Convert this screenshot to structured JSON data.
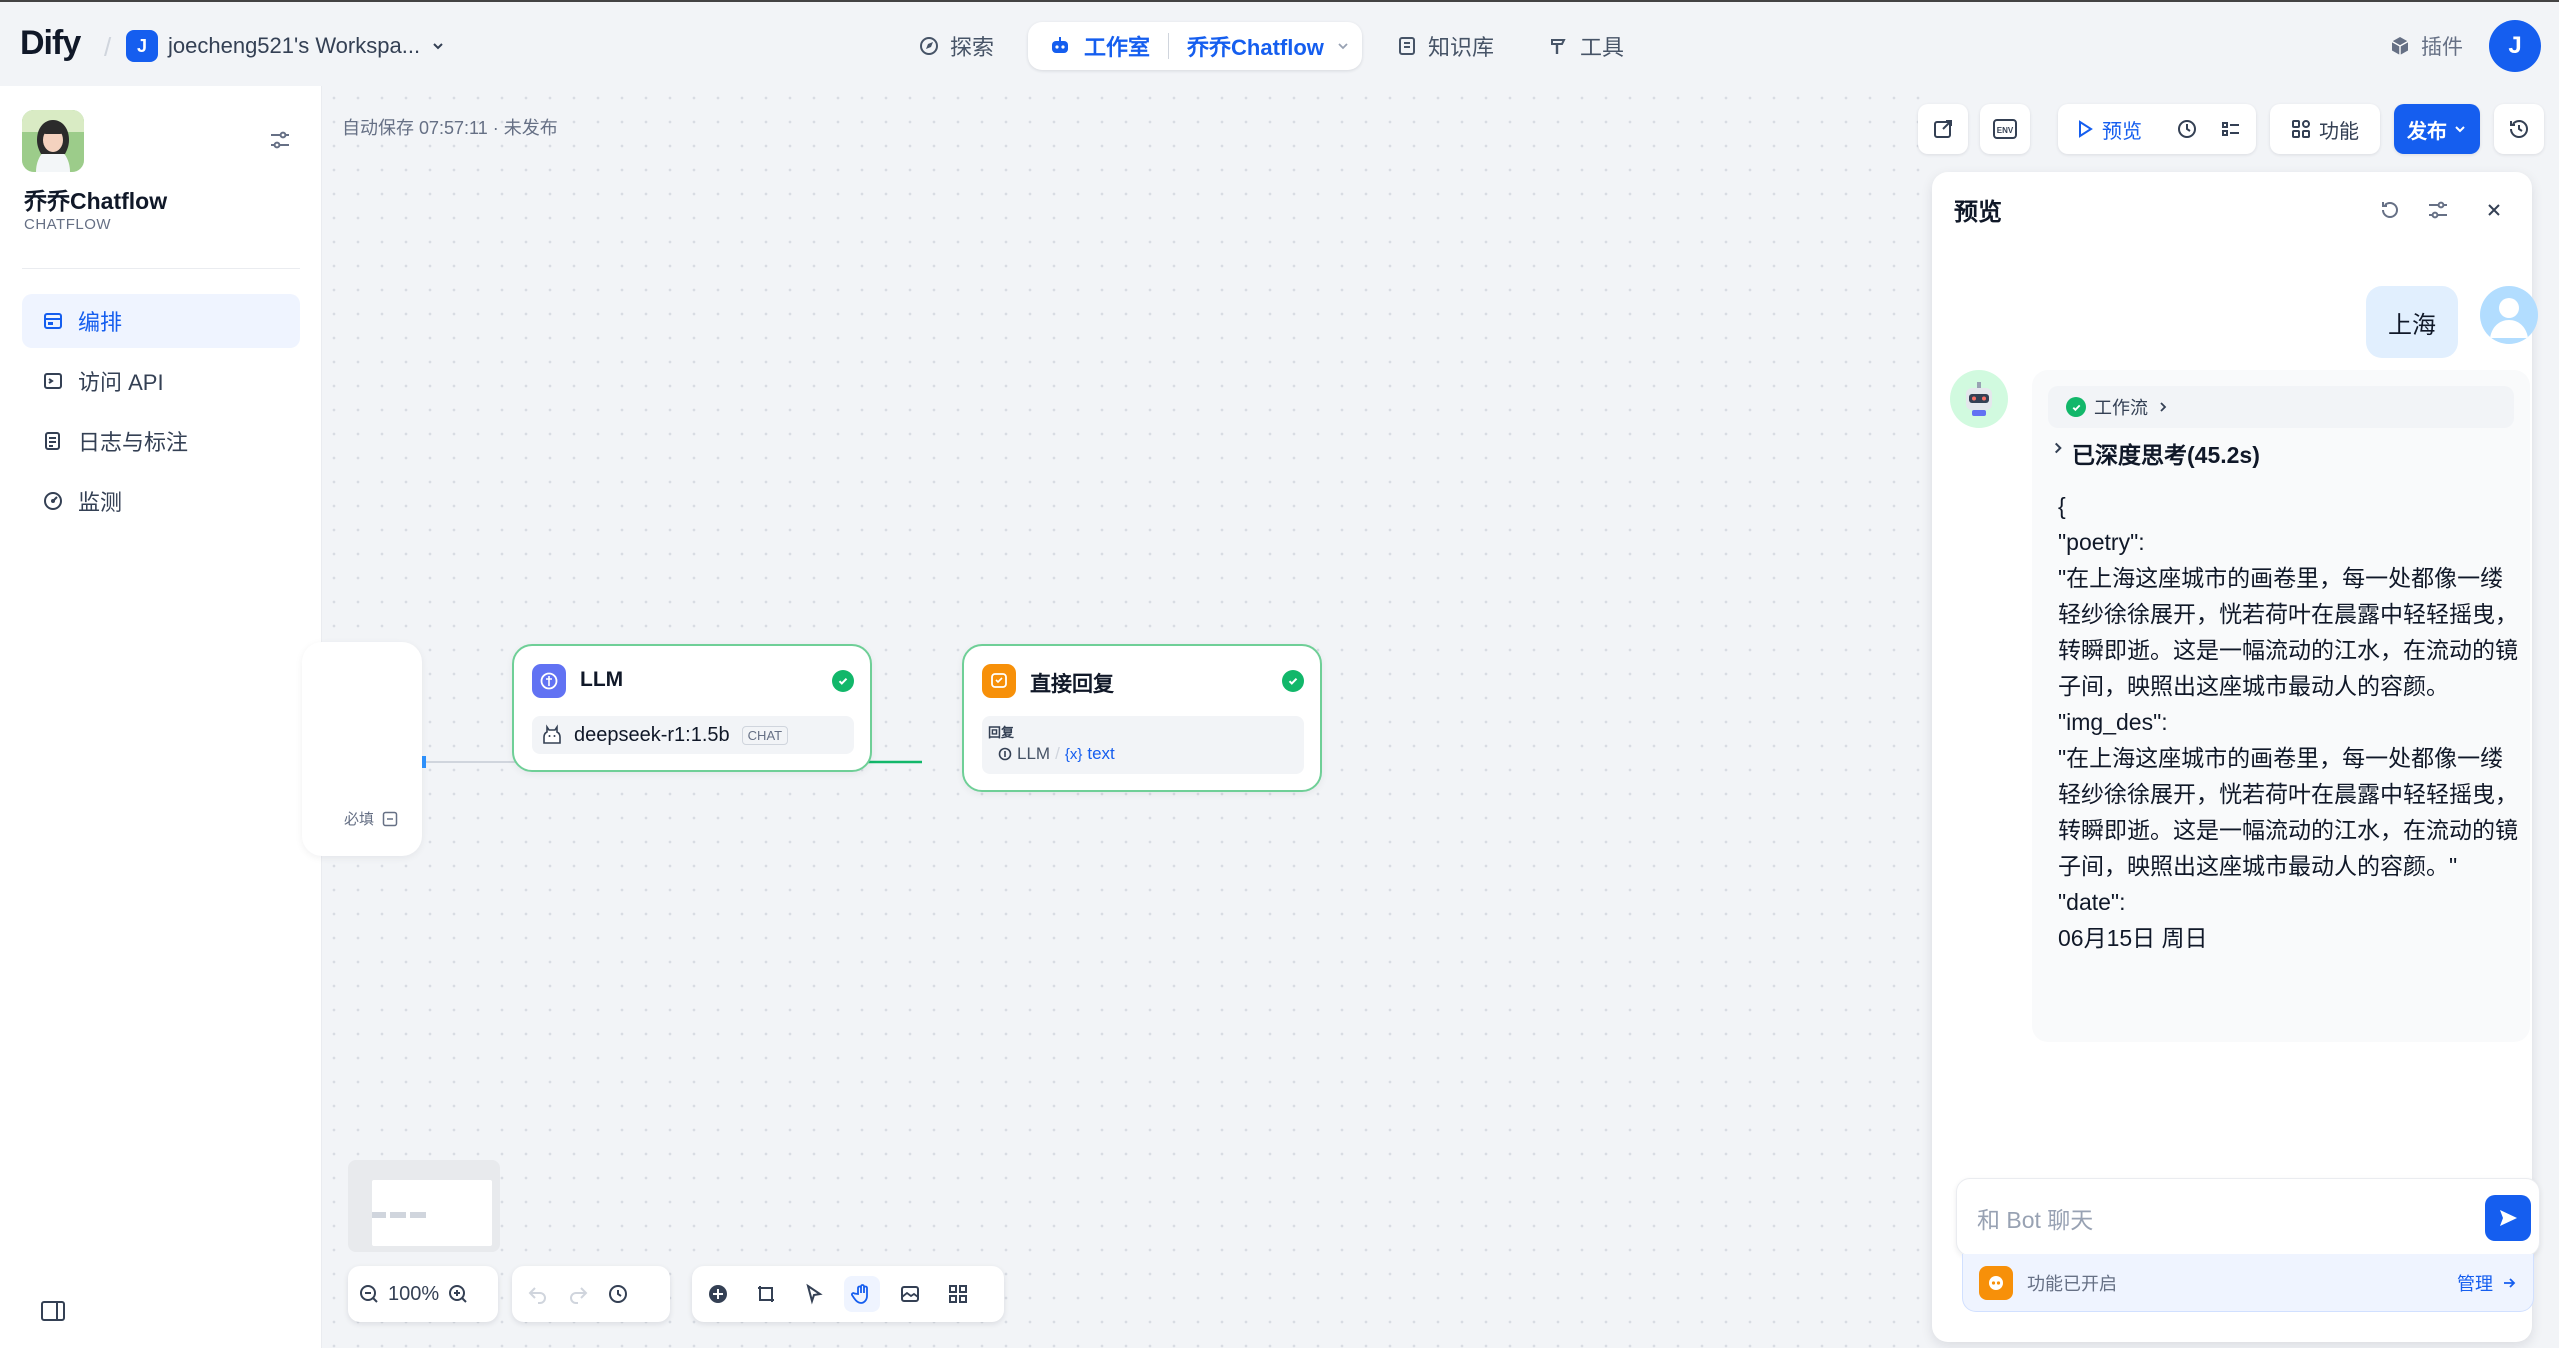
{
  "header": {
    "logo": "Dify",
    "workspace_initial": "J",
    "workspace_name": "joecheng521's Workspa...",
    "nav": {
      "explore": "探索",
      "studio": "工作室",
      "app": "乔乔Chatflow",
      "knowledge": "知识库",
      "tools": "工具"
    },
    "plugins": "插件",
    "user_initial": "J"
  },
  "sidebar": {
    "app_name": "乔乔Chatflow",
    "app_type": "CHATFLOW",
    "items": [
      {
        "label": "编排",
        "icon": "orchestrate-icon",
        "active": true
      },
      {
        "label": "访问 API",
        "icon": "terminal-icon",
        "active": false
      },
      {
        "label": "日志与标注",
        "icon": "logs-icon",
        "active": false
      },
      {
        "label": "监测",
        "icon": "monitor-icon",
        "active": false
      }
    ]
  },
  "canvas": {
    "autosave": "自动保存 07:57:11 · 未发布",
    "start_node": {
      "required": "必填"
    },
    "llm_node": {
      "title": "LLM",
      "model": "deepseek-r1:1.5b",
      "model_tag": "CHAT"
    },
    "answer_node": {
      "title": "直接回复",
      "label": "回复",
      "var_source": "LLM",
      "var_sep": "/",
      "var_name": "text"
    },
    "zoom": "100%"
  },
  "toolbar": {
    "preview": "预览",
    "features": "功能",
    "publish": "发布"
  },
  "preview_panel": {
    "title": "预览",
    "user_message": "上海",
    "workflow_label": "工作流",
    "thinking": "已深度思考(45.2s)",
    "answer_lines": [
      "{",
      "\"poetry\":",
      "\"在上海这座城市的画卷里，每一处都像一缕轻纱徐徐展开，恍若荷叶在晨露中轻轻摇曳，转瞬即逝。这是一幅流动的江水，在流动的镜子间，映照出这座城市最动人的容颜。",
      "\"img_des\":",
      "\"在上海这座城市的画卷里，每一处都像一缕轻纱徐徐展开，恍若荷叶在晨露中轻轻摇曳，转瞬即逝。这是一幅流动的江水，在流动的镜子间，映照出这座城市最动人的容颜。\"",
      "\"date\":",
      "06月15日 周日"
    ],
    "input_placeholder": "和 Bot 聊天",
    "features_enabled": "功能已开启",
    "manage": "管理"
  },
  "colors": {
    "primary": "#155eef",
    "success": "#12b76a",
    "node_border": "#6fcf97",
    "answer_icon": "#f79009",
    "llm_icon": "#6172f3"
  }
}
